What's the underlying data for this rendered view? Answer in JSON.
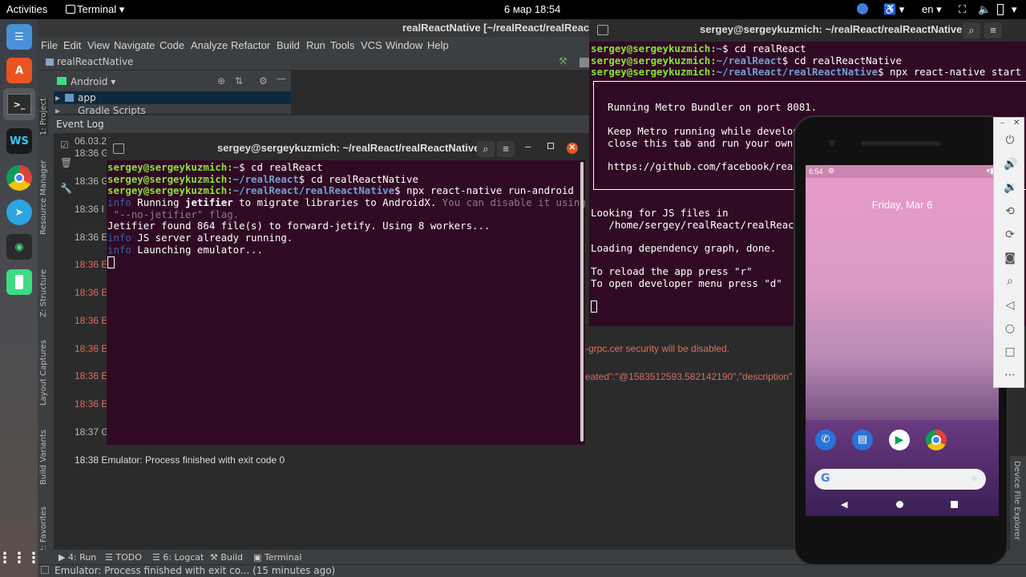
{
  "topbar": {
    "activities": "Activities",
    "app": "Terminal ▾",
    "clock": "6 мар  18:54",
    "lang": "en ▾"
  },
  "studio": {
    "title": "realReactNative [~/realReact/realReactN",
    "menu": [
      "File",
      "Edit",
      "View",
      "Navigate",
      "Code",
      "Analyze",
      "Refactor",
      "Build",
      "Run",
      "Tools",
      "VCS",
      "Window",
      "Help"
    ],
    "nav_project": "realReactNative",
    "view_mode": "Android",
    "tree": [
      "app",
      "Gradle Scripts"
    ],
    "event_log": "Event Log",
    "log_date": "06.03.20",
    "log": [
      {
        "time": "18:36 G",
        "err": false
      },
      {
        "time": "18:36 G",
        "err": false
      },
      {
        "time": "18:36 I",
        "err": false
      },
      {
        "time": "18:36 E",
        "err": false
      },
      {
        "time": "18:36 E",
        "err": true
      },
      {
        "time": "18:36 E",
        "err": true
      },
      {
        "time": "18:36 E",
        "err": true
      },
      {
        "time": "18:36 E",
        "err": true
      },
      {
        "time": "18:36 E",
        "err": true
      },
      {
        "time": "18:36 E",
        "err": true
      },
      {
        "time": "18:37 G",
        "err": false
      }
    ],
    "last_log": "18:38 Emulator: Process finished with exit code 0",
    "log_right1": "-grpc.cer security will be disabled.",
    "log_right2": "eated\":\"@1583512593.582142190\",\"description\"",
    "side_tabs": [
      "1: Project",
      "Resource Manager",
      "Z: Structure",
      "Layout Captures",
      "Build Variants",
      "2: Favorites"
    ],
    "right_tab": "Device File Explorer",
    "bottom_tabs": [
      "4: Run",
      "TODO",
      "6: Logcat",
      "Build",
      "Terminal"
    ],
    "status": "Emulator: Process finished with exit co... (15 minutes ago)"
  },
  "term1": {
    "title": "sergey@sergeykuzmich: ~/realReact/realReactNative",
    "user": "sergey@sergeykuzmich",
    "p1": "~",
    "c1": "$ cd realReact",
    "p2": "~/realReact",
    "c2": "$ cd realReactNative",
    "p3": "~/realReact/realReactNative",
    "c3": "$ npx react-native run-android",
    "info": "info",
    "i1a": " Running ",
    "i1b": "jetifier",
    "i1c": " to migrate libraries to AndroidX.",
    "i1d": " You can disable it using",
    "i1e": " \"--no-jetifier\" flag.",
    "l5": "Jetifier found 864 file(s) to forward-jetify. Using 8 workers...",
    "i2": " JS server already running.",
    "i3": " Launching emulator..."
  },
  "term2": {
    "title": "sergey@sergeykuzmich: ~/realReact/realReactNative",
    "user": "sergey@sergeykuzmich",
    "p1": "~",
    "c1": "$ cd realReact",
    "p2": "~/realReact",
    "c2": "$ cd realReactNative",
    "p3": "~/realReact/realReactNative",
    "c3": "$ npx react-native start",
    "box1": "Running Metro Bundler on port 8081.",
    "box2": "Keep Metro running while develop",
    "box3": "close this tab and run your own",
    "box4": "https://github.com/facebook/reac",
    "o1": "Looking for JS files in",
    "o2": "   /home/sergey/realReact/realReact",
    "o3": "Loading dependency graph, done.",
    "o4": "To reload the app press \"r\"",
    "o5": "To open developer menu press \"d\""
  },
  "phone": {
    "time": "6:54",
    "date": "Friday, Mar 6"
  }
}
